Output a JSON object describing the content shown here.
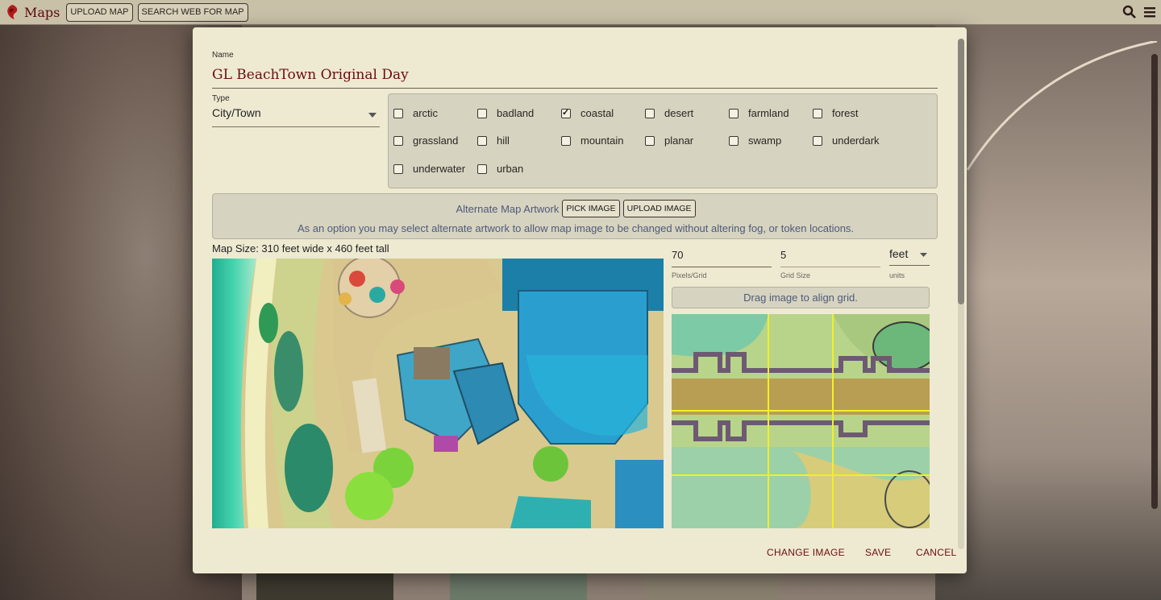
{
  "app": {
    "title": "Maps",
    "upload_map_label": "UPLOAD MAP",
    "search_web_label": "SEARCH WEB FOR MAP"
  },
  "modal": {
    "name_label": "Name",
    "name_value": "GL BeachTown Original Day",
    "type_label": "Type",
    "type_value": "City/Town",
    "terrains": [
      {
        "label": "arctic",
        "checked": false
      },
      {
        "label": "badland",
        "checked": false
      },
      {
        "label": "coastal",
        "checked": true
      },
      {
        "label": "desert",
        "checked": false
      },
      {
        "label": "farmland",
        "checked": false
      },
      {
        "label": "forest",
        "checked": false
      },
      {
        "label": "grassland",
        "checked": false
      },
      {
        "label": "hill",
        "checked": false
      },
      {
        "label": "mountain",
        "checked": false
      },
      {
        "label": "planar",
        "checked": false
      },
      {
        "label": "swamp",
        "checked": false
      },
      {
        "label": "underdark",
        "checked": false
      },
      {
        "label": "underwater",
        "checked": false
      },
      {
        "label": "urban",
        "checked": false
      }
    ],
    "alt_artwork": {
      "label": "Alternate Map Artwork",
      "pick_label": "PICK IMAGE",
      "upload_label": "UPLOAD IMAGE",
      "description": "As an option you may select alternate artwork to allow map image to be changed without altering fog, or token locations."
    },
    "map_size": "Map Size: 310 feet wide x 460 feet tall",
    "grid": {
      "pixels_value": "70",
      "pixels_label": "Pixels/Grid",
      "size_value": "5",
      "size_label": "Grid Size",
      "units_value": "feet",
      "units_label": "units",
      "drag_label": "Drag image to align grid."
    },
    "footer": {
      "change_image": "CHANGE IMAGE",
      "save": "SAVE",
      "cancel": "CANCEL"
    }
  },
  "colors": {
    "accent": "#6b0d0d",
    "modal_bg": "#eeead2",
    "panel_bg": "#d6d3c0",
    "grid_line": "#f2ef2a"
  }
}
